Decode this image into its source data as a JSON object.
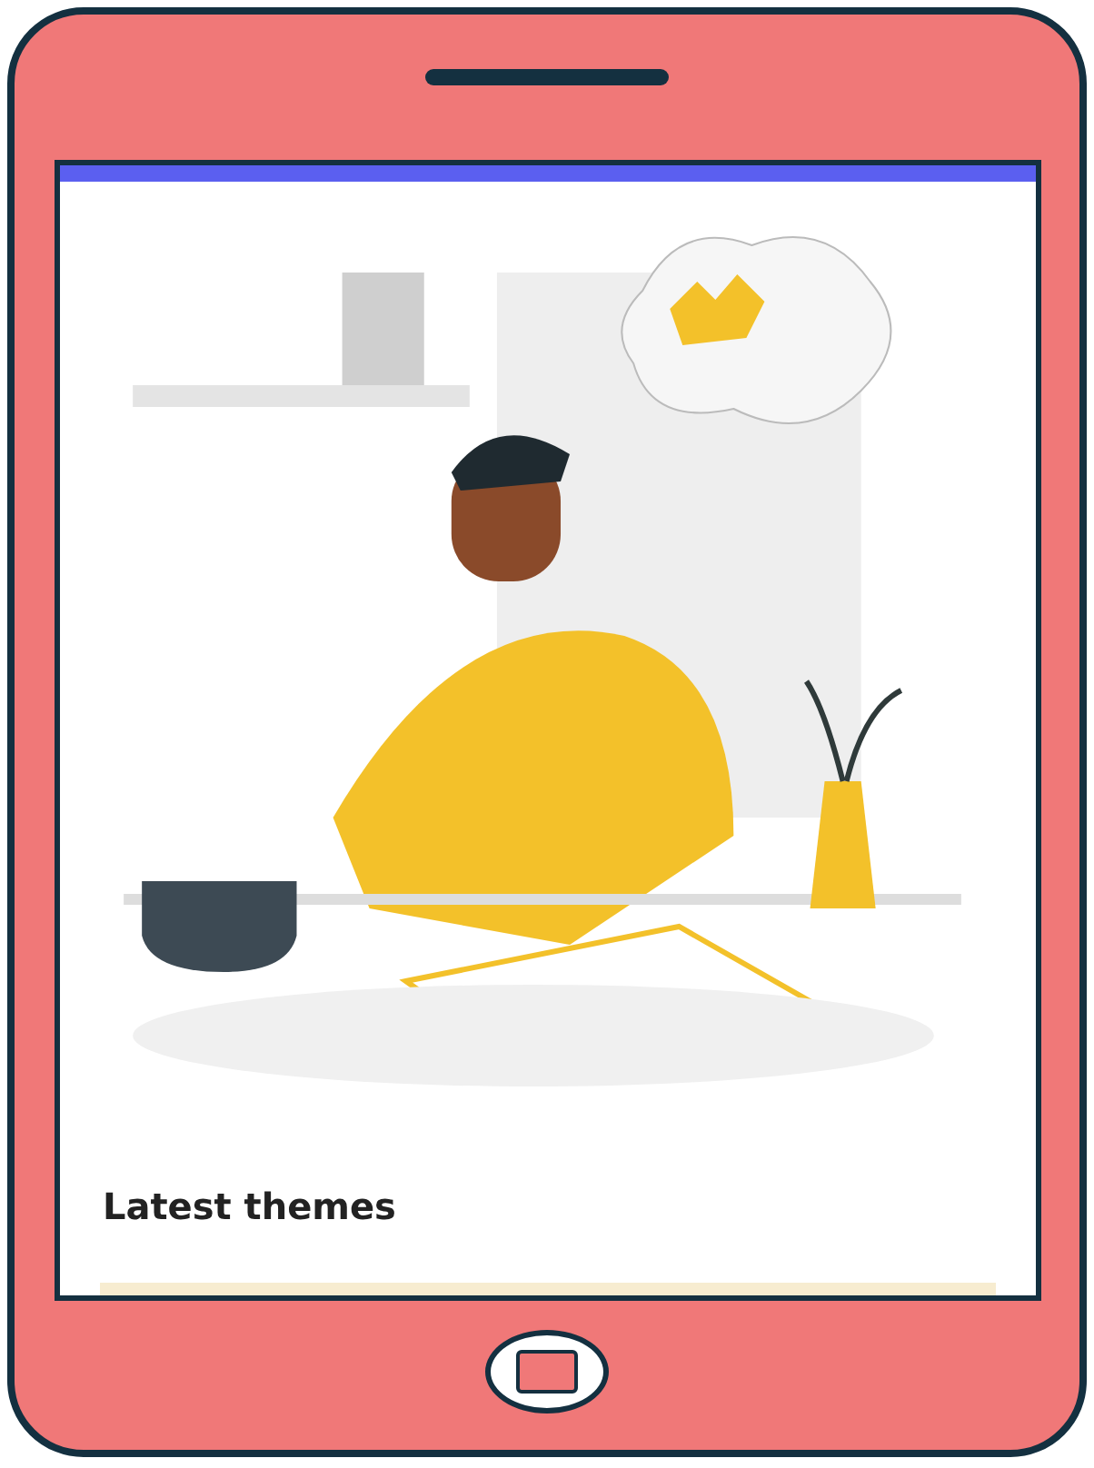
{
  "screen": {
    "heading": "Latest themes"
  }
}
